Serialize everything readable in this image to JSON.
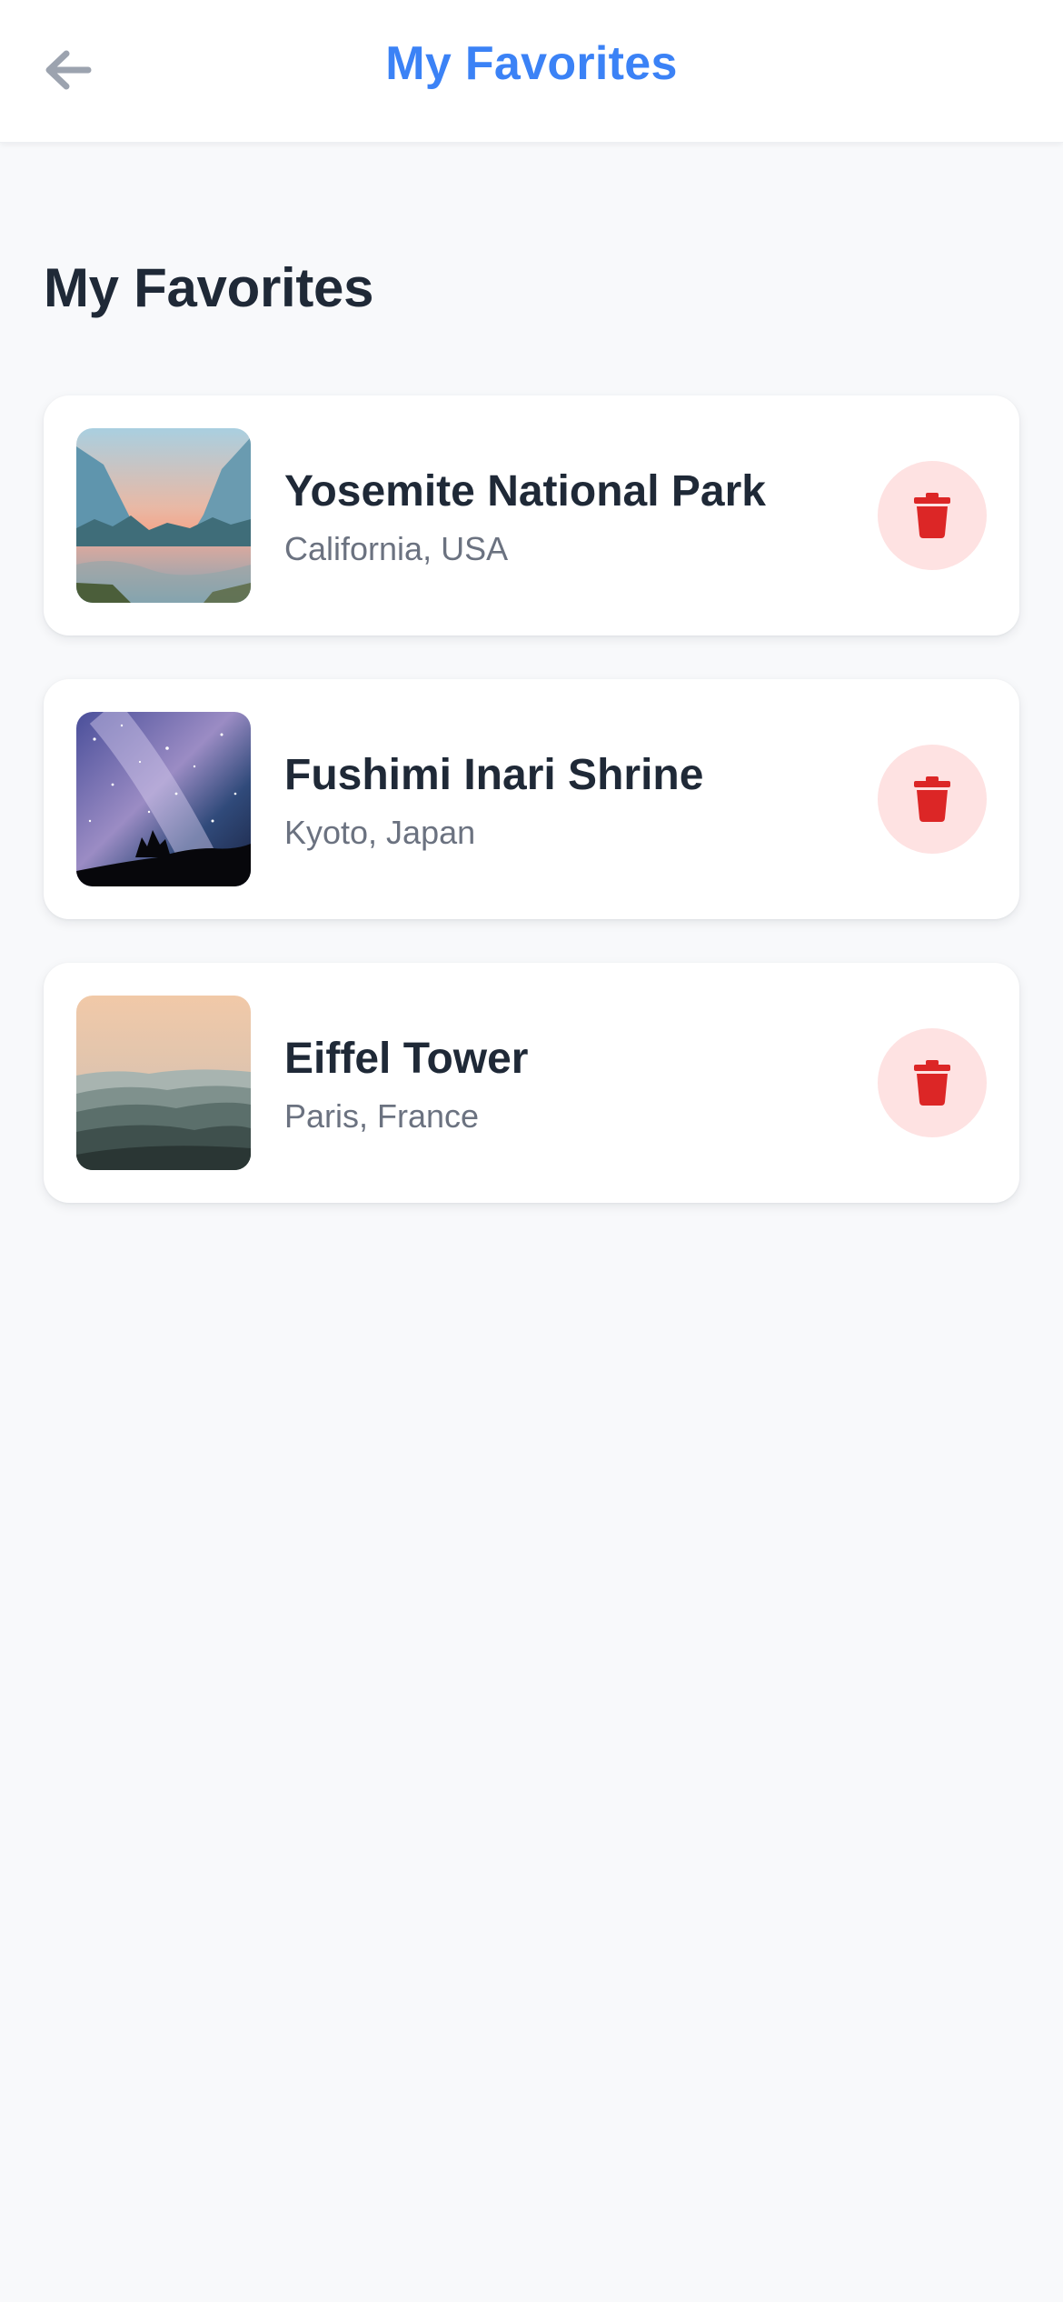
{
  "header": {
    "title": "My Favorites",
    "back_icon": "arrow-left-icon",
    "accent_color": "#3b82f6"
  },
  "page": {
    "title": "My Favorites"
  },
  "favorites": [
    {
      "name": "Yosemite National Park",
      "location": "California, USA",
      "image": "valley-sunset-photo",
      "delete_icon": "trash-icon"
    },
    {
      "name": "Fushimi Inari Shrine",
      "location": "Kyoto, Japan",
      "image": "starry-sky-photo",
      "delete_icon": "trash-icon"
    },
    {
      "name": "Eiffel Tower",
      "location": "Paris, France",
      "image": "misty-mountains-photo",
      "delete_icon": "trash-icon"
    }
  ],
  "colors": {
    "delete_icon": "#dc2626",
    "delete_bg": "#fee2e2",
    "text_primary": "#1f2937",
    "text_secondary": "#6b7280"
  }
}
